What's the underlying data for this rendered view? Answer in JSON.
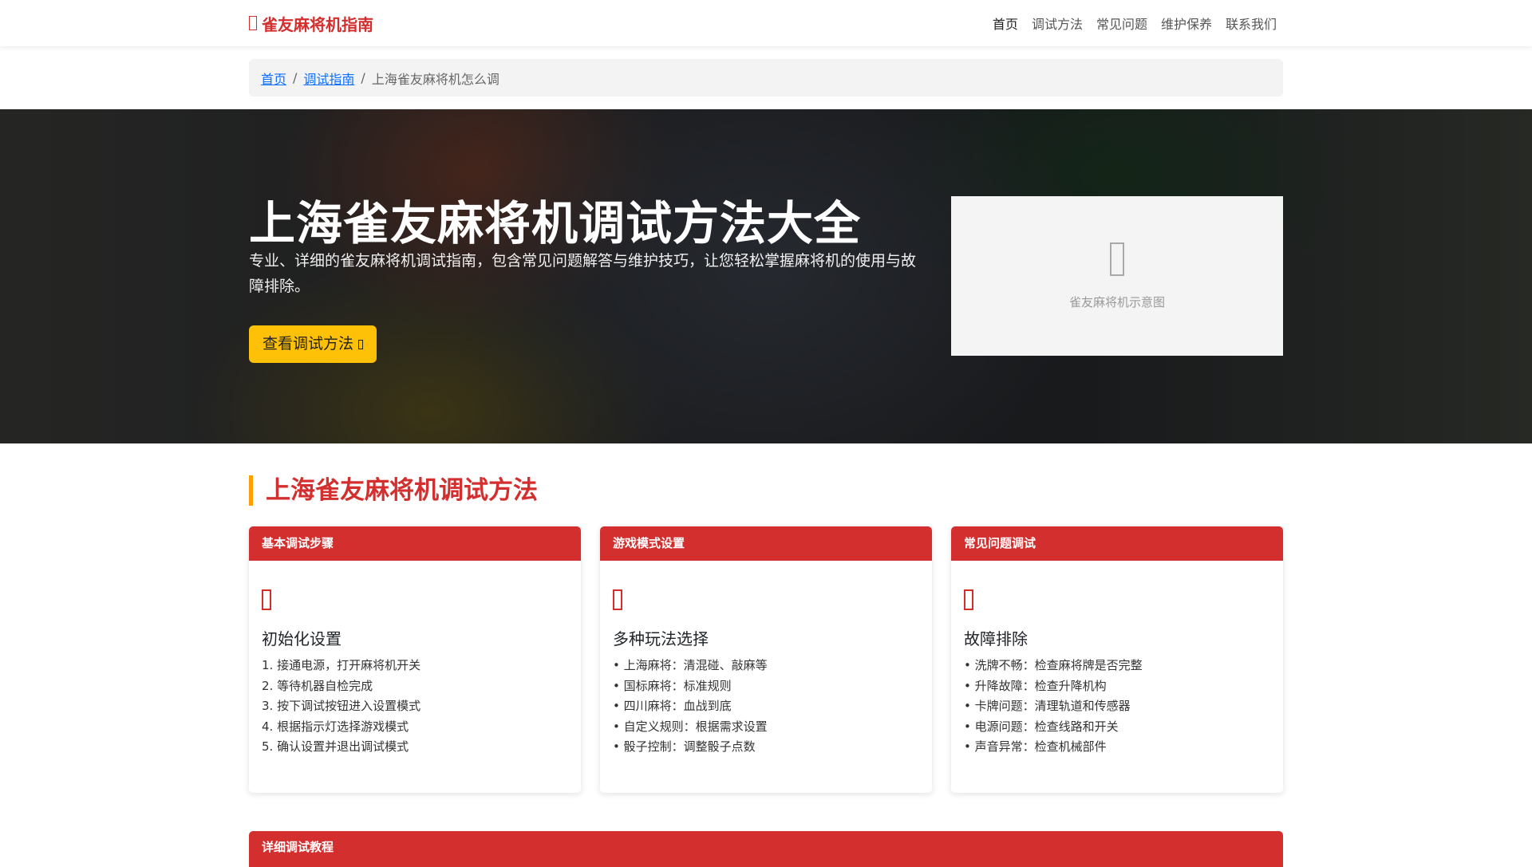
{
  "nav": {
    "brand": "雀友麻将机指南",
    "items": [
      "首页",
      "调试方法",
      "常见问题",
      "维护保养",
      "联系我们"
    ]
  },
  "breadcrumb": {
    "home": "首页",
    "guide": "调试指南",
    "current": "上海雀友麻将机怎么调",
    "sep": "/"
  },
  "hero": {
    "title": "上海雀友麻将机调试方法大全",
    "subtitle": "专业、详细的雀友麻将机调试指南，包含常见问题解答与维护技巧，让您轻松掌握麻将机的使用与故障排除。",
    "button": "查看调试方法",
    "image_caption": "雀友麻将机示意图"
  },
  "section": {
    "title": "上海雀友麻将机调试方法"
  },
  "cards": [
    {
      "header": "基本调试步骤",
      "title": "初始化设置",
      "items": [
        "1. 接通电源，打开麻将机开关",
        "2. 等待机器自检完成",
        "3. 按下调试按钮进入设置模式",
        "4. 根据指示灯选择游戏模式",
        "5. 确认设置并退出调试模式"
      ]
    },
    {
      "header": "游戏模式设置",
      "title": "多种玩法选择",
      "items": [
        "• 上海麻将：清混碰、敲麻等",
        "• 国标麻将：标准规则",
        "• 四川麻将：血战到底",
        "• 自定义规则：根据需求设置",
        "• 骰子控制：调整骰子点数"
      ]
    },
    {
      "header": "常见问题调试",
      "title": "故障排除",
      "items": [
        "• 洗牌不畅：检查麻将牌是否完整",
        "• 升降故障：检查升降机构",
        "• 卡牌问题：清理轨道和传感器",
        "• 电源问题：检查线路和开关",
        "• 声音异常：检查机械部件"
      ]
    }
  ],
  "bottom": {
    "header": "详细调试教程"
  }
}
